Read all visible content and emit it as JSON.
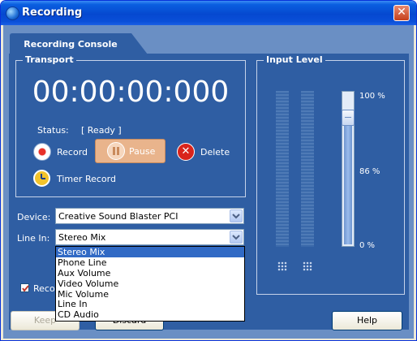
{
  "window": {
    "title": "Recording"
  },
  "tab": {
    "label": "Recording Console"
  },
  "transport": {
    "title": "Transport",
    "time": "00:00:00:000",
    "status_label": "Status:",
    "status_value": "[ Ready ]",
    "record_label": "Record",
    "pause_label": "Pause",
    "delete_label": "Delete",
    "timer_label": "Timer Record"
  },
  "input_level": {
    "title": "Input Level",
    "ticks": [
      "100 %",
      "86 %",
      "0 %"
    ],
    "slider_level_percent": 93
  },
  "device": {
    "label": "Device:",
    "value": "Creative Sound Blaster PCI"
  },
  "line_in": {
    "label": "Line In:",
    "value": "Stereo Mix",
    "options": [
      "Stereo Mix",
      "Phone Line",
      "Aux Volume",
      "Video Volume",
      "Mic Volume",
      "Line In",
      "CD Audio"
    ]
  },
  "checkbox": {
    "label_visible": "Reco",
    "checked": true
  },
  "buttons": {
    "keep": "Keep",
    "discard": "Discard",
    "help": "Help"
  },
  "colors": {
    "accent": "#2f5ea3",
    "pause_bg": "#e9b48c",
    "record_red": "#e8312a"
  }
}
